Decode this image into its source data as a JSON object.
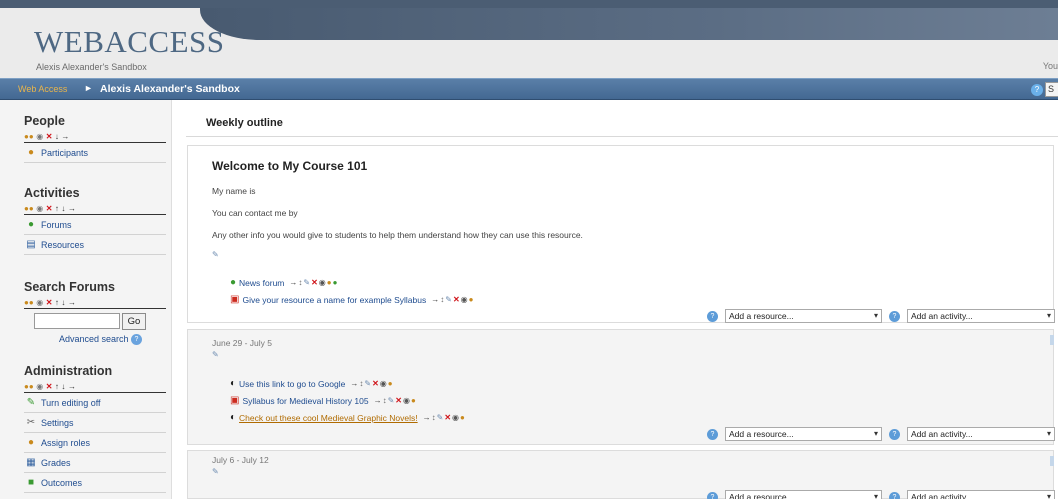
{
  "header": {
    "logo": "WEBACCESS",
    "subtitle": "Alexis Alexander's Sandbox",
    "user_text": "You"
  },
  "navbar": {
    "home": "Web Access",
    "separator": "►",
    "current": "Alexis Alexander's Sandbox",
    "button_label": "S"
  },
  "sidebar": {
    "people": {
      "title": "People",
      "items": [
        {
          "label": "Participants",
          "icon": "participants-icon"
        }
      ]
    },
    "activities": {
      "title": "Activities",
      "items": [
        {
          "label": "Forums",
          "icon": "forum-icon"
        },
        {
          "label": "Resources",
          "icon": "resource-icon"
        }
      ]
    },
    "search": {
      "title": "Search Forums",
      "go_label": "Go",
      "advanced_label": "Advanced search"
    },
    "administration": {
      "title": "Administration",
      "items": [
        {
          "label": "Turn editing off",
          "icon": "edit-icon"
        },
        {
          "label": "Settings",
          "icon": "settings-icon"
        },
        {
          "label": "Assign roles",
          "icon": "roles-icon"
        },
        {
          "label": "Grades",
          "icon": "grades-icon"
        },
        {
          "label": "Outcomes",
          "icon": "outcomes-icon"
        }
      ]
    }
  },
  "main": {
    "outline_title": "Weekly outline",
    "section0": {
      "title": "Welcome to My Course 101",
      "lines": [
        "My name is",
        "You can contact me by",
        "Any other info you would give to students to help them understand how they can use this resource."
      ],
      "activities": [
        {
          "label": "News forum",
          "icon": "forum-icon"
        },
        {
          "label": "Give your resource a name for example Syllabus",
          "icon": "pdf-icon"
        }
      ]
    },
    "section1": {
      "date": "June 29 - July 5",
      "activities": [
        {
          "label": "Use this link to go to Google",
          "icon": "web-link-icon"
        },
        {
          "label": "Syllabus for Medieval History 105",
          "icon": "pdf-icon"
        },
        {
          "label": "Check out these cool Medieval Graphic Novels!",
          "icon": "web-link-icon"
        }
      ]
    },
    "section2": {
      "date": "July 6 - July 12"
    },
    "add_resource": "Add a resource...",
    "add_activity": "Add an activity..."
  }
}
